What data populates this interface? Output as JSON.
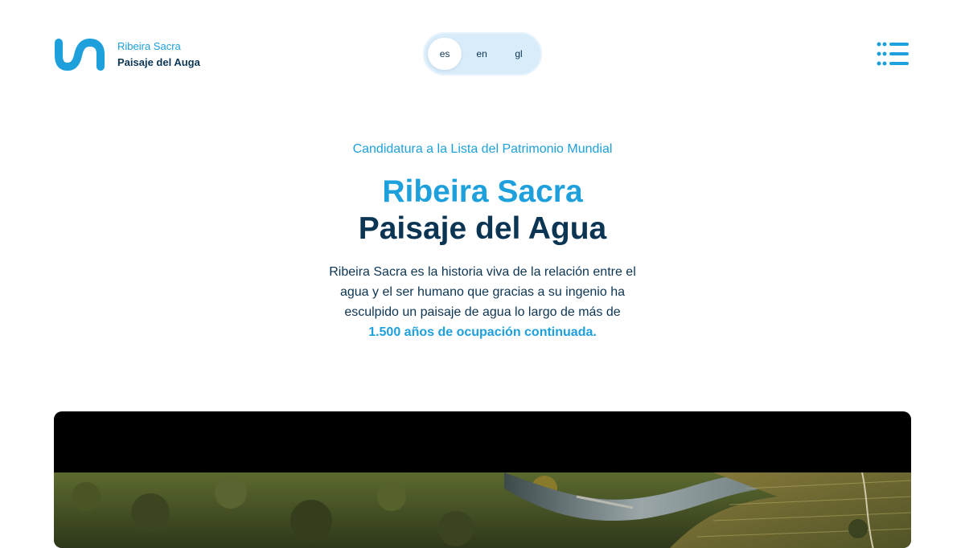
{
  "header": {
    "logo": {
      "line1": "Ribeira Sacra",
      "line2": "Paisaje del Auga",
      "icon": "wave-s-logo-icon"
    },
    "languages": [
      {
        "code": "es",
        "active": true
      },
      {
        "code": "en",
        "active": false
      },
      {
        "code": "gl",
        "active": false
      }
    ],
    "menu_icon": "menu-grid-icon"
  },
  "hero": {
    "eyebrow": "Candidatura a la Lista del Patrimonio Mundial",
    "title_line1": "Ribeira Sacra",
    "title_line2": "Paisaje del Agua",
    "lead_line1": "Ribeira Sacra es la historia viva de la relación entre el",
    "lead_line2": "agua y el ser humano que gracias a su ingenio ha",
    "lead_line3": "esculpido un paisaje de agua lo largo de más de",
    "lead_highlight": "1.500 años de ocupación continuada."
  },
  "colors": {
    "accent": "#1ea0dc",
    "navy": "#0c3554",
    "lang_bg": "#d8ecfa"
  }
}
